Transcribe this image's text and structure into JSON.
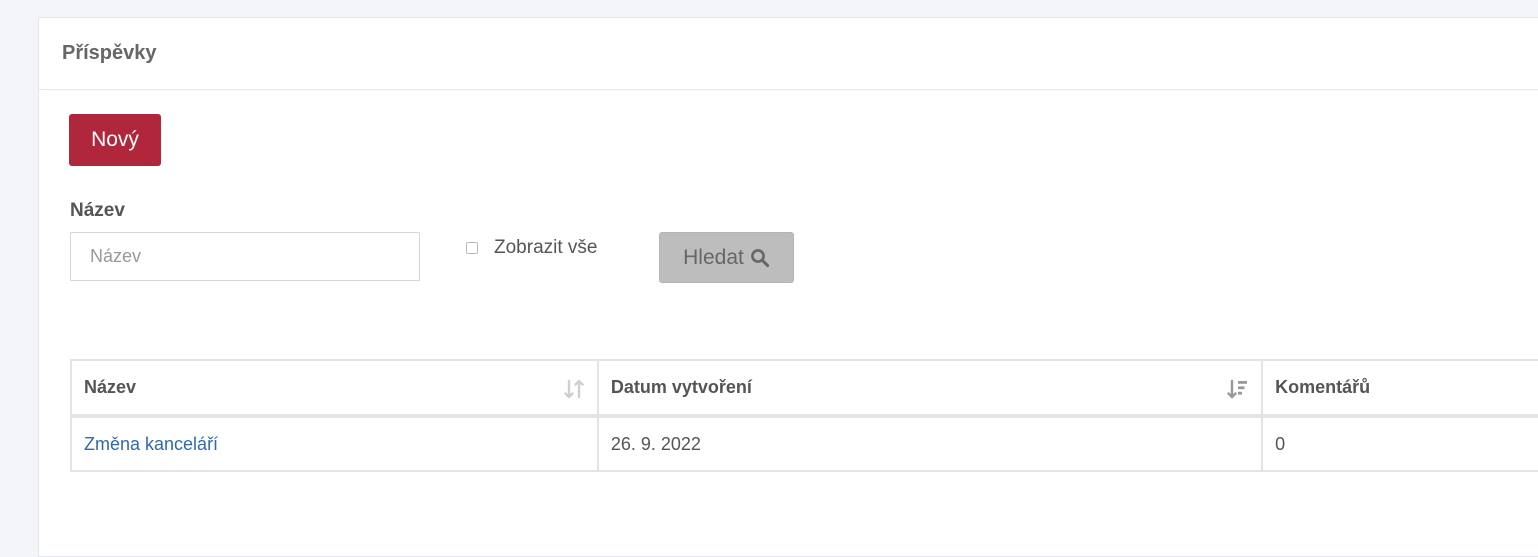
{
  "header": {
    "title": "Příspěvky"
  },
  "toolbar": {
    "new_label": "Nový"
  },
  "filter": {
    "name_label": "Název",
    "name_placeholder": "Název",
    "name_value": "",
    "show_all_label": "Zobrazit vše",
    "show_all_checked": false,
    "search_label": "Hledat",
    "search_icon": "search-icon"
  },
  "table": {
    "columns": [
      {
        "label": "Název",
        "sort_icon": "sort-neutral-icon"
      },
      {
        "label": "Datum vytvoření",
        "sort_icon": "sort-descending-icon"
      },
      {
        "label": "Komentářů"
      }
    ],
    "rows": [
      {
        "name": "Změna kanceláří",
        "created": "26. 9. 2022",
        "comments": "0"
      }
    ]
  },
  "colors": {
    "accent": "#b0263a",
    "link": "#2e6aad",
    "background": "#f4f5f8",
    "button_disabled": "#bdbdbd"
  }
}
